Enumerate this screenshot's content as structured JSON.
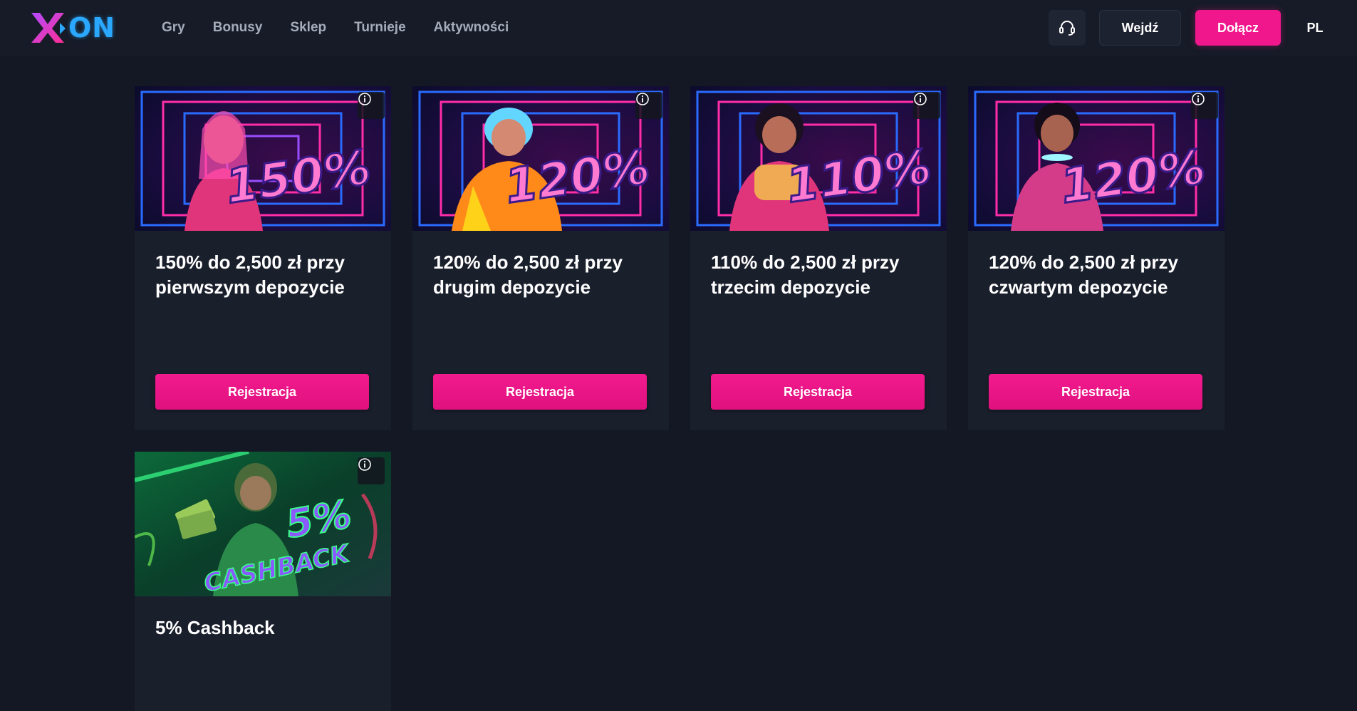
{
  "header": {
    "logo_text": "ON",
    "nav": [
      "Gry",
      "Bonusy",
      "Sklep",
      "Turnieje",
      "Aktywności"
    ],
    "login_label": "Wejdź",
    "join_label": "Dołącz",
    "language": "PL",
    "support_icon": "headset-icon"
  },
  "colors": {
    "accent": "#f0168b",
    "background": "#141824",
    "card": "#1a1f2c",
    "header": "#161b27"
  },
  "bonuses": [
    {
      "banner_text": "150%",
      "title": "150% do 2,500 zł przy pierwszym depozycie",
      "button": "Rejestracja",
      "theme": "pink"
    },
    {
      "banner_text": "120%",
      "title": "120% do 2,500 zł przy drugim depozycie",
      "button": "Rejestracja",
      "theme": "orange"
    },
    {
      "banner_text": "110%",
      "title": "110% do 2,500 zł przy trzecim depozycie",
      "button": "Rejestracja",
      "theme": "pink"
    },
    {
      "banner_text": "120%",
      "title": "120% do 2,500 zł przy czwartym depozycie",
      "button": "Rejestracja",
      "theme": "pink"
    },
    {
      "banner_text": "5%",
      "banner_subtext": "CASHBACK",
      "title": "5% Cashback",
      "theme": "green"
    }
  ]
}
